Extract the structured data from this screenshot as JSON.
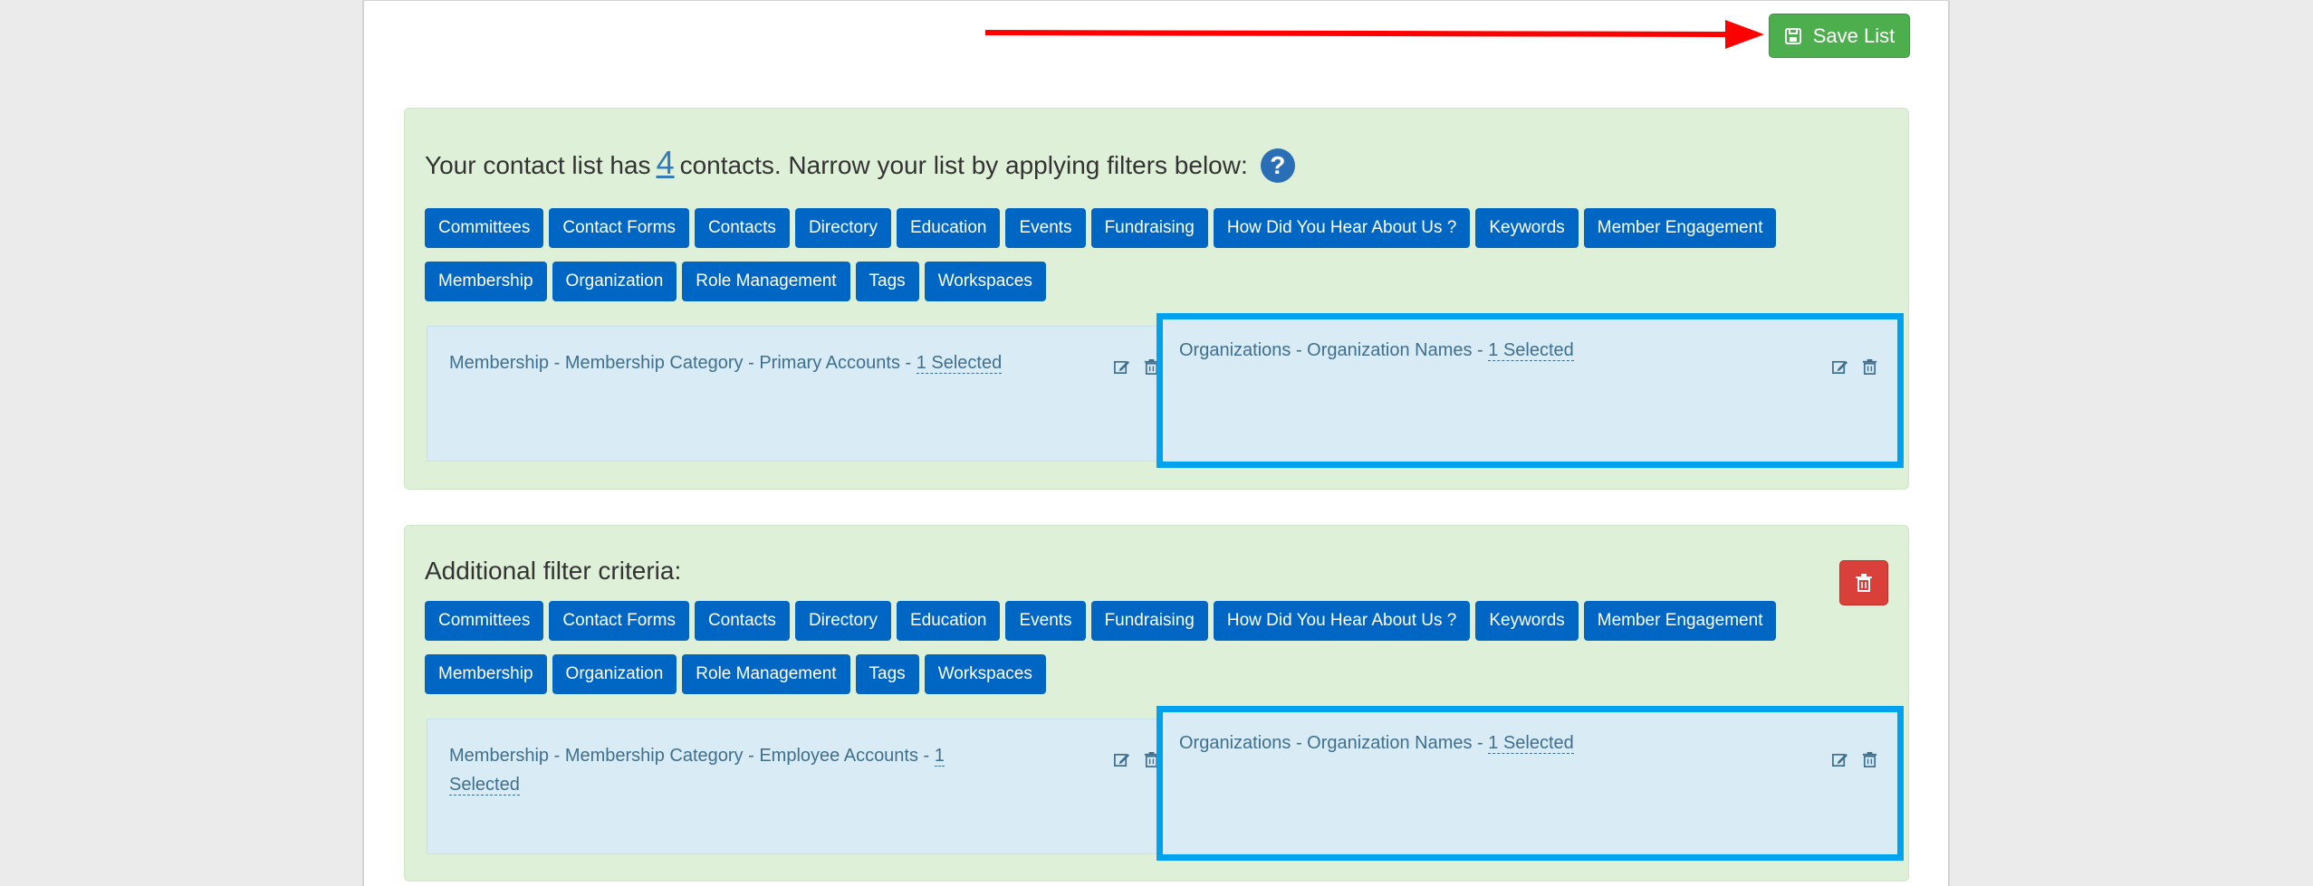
{
  "toolbar": {
    "save_label": "Save List"
  },
  "main_panel": {
    "title_prefix": "Your contact list has",
    "contact_count": "4",
    "title_suffix": "contacts. Narrow your list by applying filters below:",
    "help_symbol": "?",
    "categories_row1": [
      "Committees",
      "Contact Forms",
      "Contacts",
      "Directory",
      "Education",
      "Events",
      "Fundraising",
      "How Did You Hear About Us ?",
      "Keywords",
      "Member Engagement"
    ],
    "categories_row2": [
      "Membership",
      "Organization",
      "Role Management",
      "Tags",
      "Workspaces"
    ],
    "filters": [
      {
        "text": "Membership - Membership Category - Primary Accounts -",
        "selected": "1 Selected"
      },
      {
        "text": "Organizations - Organization Names -",
        "selected": "1 Selected"
      }
    ]
  },
  "additional_panel": {
    "title": "Additional filter criteria:",
    "categories_row1": [
      "Committees",
      "Contact Forms",
      "Contacts",
      "Directory",
      "Education",
      "Events",
      "Fundraising",
      "How Did You Hear About Us ?",
      "Keywords",
      "Member Engagement"
    ],
    "categories_row2": [
      "Membership",
      "Organization",
      "Role Management",
      "Tags",
      "Workspaces"
    ],
    "filters": [
      {
        "text": "Membership - Membership Category - Employee Accounts -",
        "selected_line1": "1",
        "selected_line2": "Selected"
      },
      {
        "text": "Organizations - Organization Names -",
        "selected": "1 Selected"
      }
    ]
  },
  "icons": {
    "save": "floppy-disk-icon",
    "help": "question-circle-icon",
    "edit": "edit-icon",
    "delete": "trash-icon"
  },
  "colors": {
    "save_button": "#4cae4c",
    "category_button": "#0066c4",
    "panel_background": "#dff0d8",
    "filter_background": "#d9ecf5",
    "highlight_border": "#00a2ee",
    "delete_button": "#d9403a",
    "annotation_arrow": "#ff0000"
  }
}
